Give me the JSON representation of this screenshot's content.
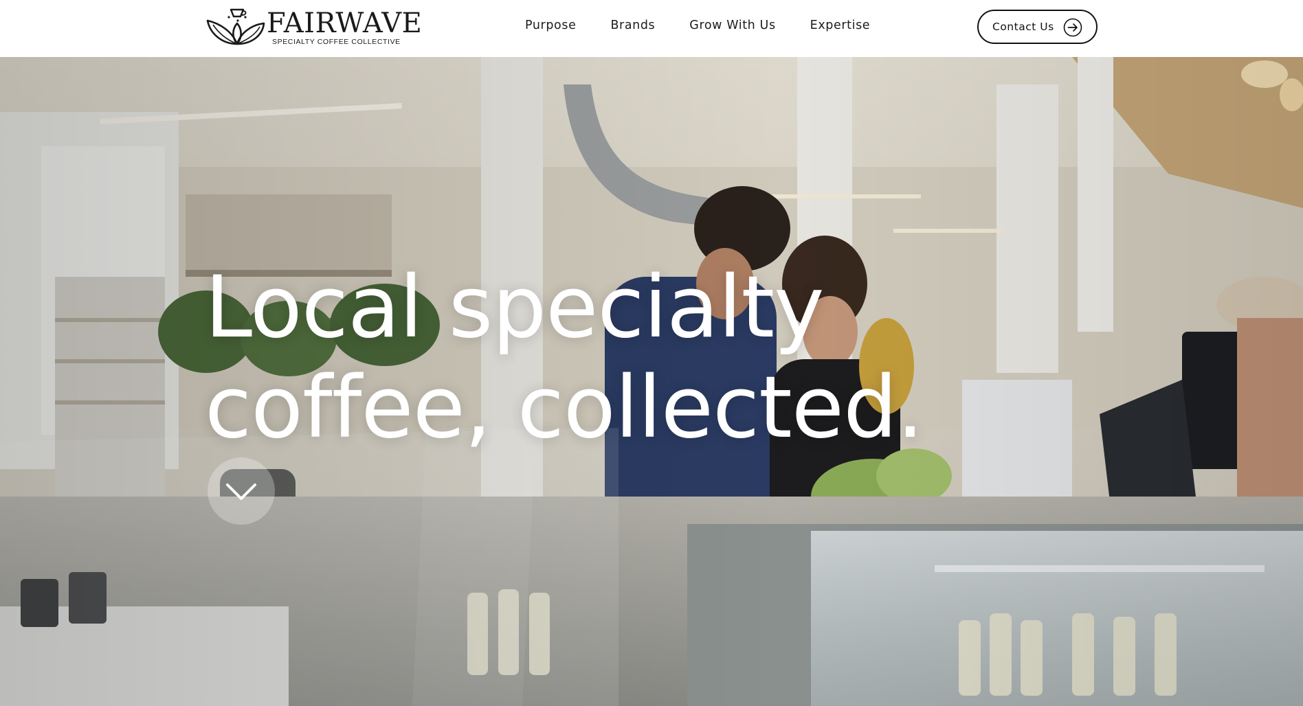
{
  "header": {
    "brand_name": "FAIRWAVE",
    "brand_tagline": "SPECIALTY COFFEE COLLECTIVE",
    "logo_icon": "coffee-cup-leaves-logo",
    "nav": [
      {
        "label": "Purpose"
      },
      {
        "label": "Brands"
      },
      {
        "label": "Grow With Us"
      },
      {
        "label": "Expertise"
      }
    ],
    "contact_button": {
      "label": "Contact Us",
      "icon": "arrow-right-circle-icon"
    }
  },
  "hero": {
    "headline_line_1": "Local specialty",
    "headline_line_2": "coffee, collected.",
    "scroll_icon": "chevron-down-icon",
    "background": "photo of a bright coffee shop interior with baristas and customers at the counter"
  },
  "colors": {
    "text_dark": "#1c1c1c",
    "hero_text": "#ffffff",
    "header_bg": "#ffffff",
    "button_border": "#111111"
  }
}
